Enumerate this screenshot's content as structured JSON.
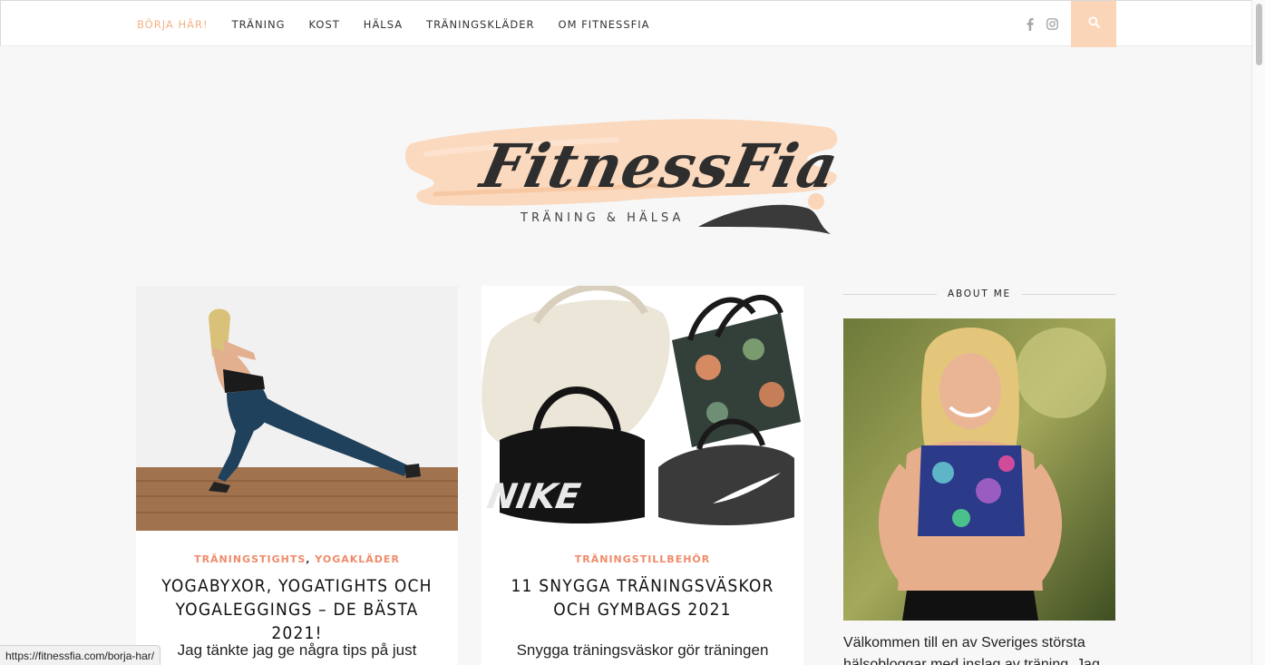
{
  "nav": {
    "items": [
      {
        "label": "BÖRJA HÄR!",
        "active": true
      },
      {
        "label": "TRÄNING"
      },
      {
        "label": "KOST"
      },
      {
        "label": "HÄLSA"
      },
      {
        "label": "TRÄNINGSKLÄDER"
      },
      {
        "label": "OM FITNESSFIA"
      }
    ],
    "social": [
      "facebook-icon",
      "instagram-icon"
    ],
    "search_icon": "search-icon"
  },
  "logo": {
    "name": "FitnessFia",
    "tagline": "TRÄNING & HÄLSA"
  },
  "posts": [
    {
      "categories": [
        "TRÄNINGSTIGHTS",
        "YOGAKLÄDER"
      ],
      "title": "YOGABYXOR, YOGATIGHTS OCH YOGALEGGINGS – DE BÄSTA 2021!",
      "excerpt": "Jag tänkte jag ge några tips på just"
    },
    {
      "categories": [
        "TRÄNINGSTILLBEHÖR"
      ],
      "title": "11 SNYGGA TRÄNINGSVÄSKOR OCH GYMBAGS 2021",
      "excerpt": "Snygga träningsväskor gör träningen"
    }
  ],
  "sidebar": {
    "about_heading": "ABOUT ME",
    "about_text": "Välkommen till en av Sveriges största hälsobloggar med inslag av träning. Jag"
  },
  "status": {
    "url": "https://fitnessfia.com/borja-har/"
  },
  "colors": {
    "accent": "#f4b384",
    "category": "#ef8b6a",
    "brush": "#fbd5b7"
  }
}
